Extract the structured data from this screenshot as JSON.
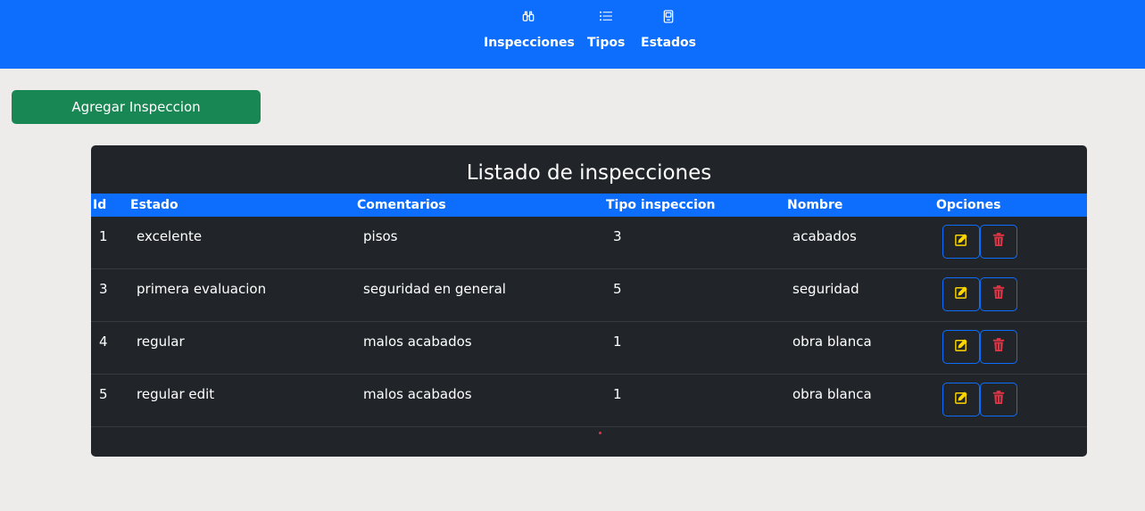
{
  "nav": {
    "items": [
      {
        "label": "Inspecciones",
        "icon": "binoculars-icon"
      },
      {
        "label": "Tipos",
        "icon": "list-icon"
      },
      {
        "label": "Estados",
        "icon": "device-icon"
      }
    ]
  },
  "actions": {
    "add_label": "Agregar Inspeccion"
  },
  "table": {
    "title": "Listado de inspecciones",
    "headers": [
      "Id",
      "Estado",
      "Comentarios",
      "Tipo inspeccion",
      "Nombre",
      "Opciones"
    ],
    "rows": [
      {
        "id": "1",
        "estado": "excelente",
        "comentarios": "pisos",
        "tipo": "3",
        "nombre": "acabados"
      },
      {
        "id": "3",
        "estado": "primera evaluacion",
        "comentarios": "seguridad en general",
        "tipo": "5",
        "nombre": "seguridad"
      },
      {
        "id": "4",
        "estado": "regular",
        "comentarios": "malos acabados",
        "tipo": "1",
        "nombre": "obra blanca"
      },
      {
        "id": "5",
        "estado": "regular edit",
        "comentarios": "malos acabados",
        "tipo": "1",
        "nombre": "obra blanca"
      }
    ]
  },
  "colors": {
    "primary": "#0d6efd",
    "success": "#198754",
    "dark": "#212529",
    "edit_icon": "#ffd600",
    "delete_icon": "#dc3545",
    "background": "#edecea"
  }
}
